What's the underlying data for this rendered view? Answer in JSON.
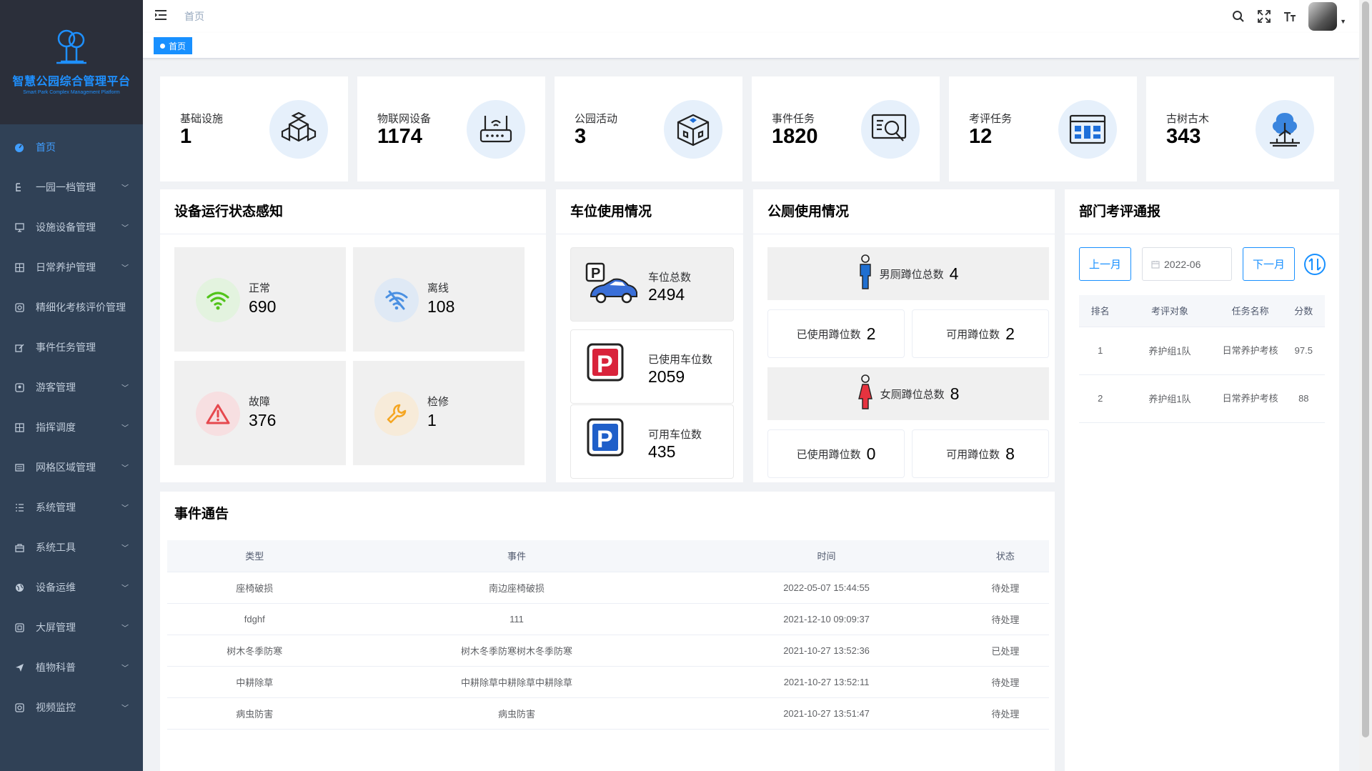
{
  "app": {
    "logo_title": "智慧公园综合管理平台",
    "logo_subtitle": "Smart Park Complex Management Platform",
    "breadcrumb": "首页",
    "active_tag": "首页"
  },
  "sidebar": {
    "items": [
      {
        "label": "首页",
        "icon": "dashboard-icon",
        "active": true
      },
      {
        "label": "一园一档管理",
        "icon": "tree-icon"
      },
      {
        "label": "设施设备管理",
        "icon": "monitor-icon"
      },
      {
        "label": "日常养护管理",
        "icon": "grid-icon"
      },
      {
        "label": "精细化考核评价管理",
        "icon": "target-icon"
      },
      {
        "label": "事件任务管理",
        "icon": "edit-icon"
      },
      {
        "label": "游客管理",
        "icon": "user-icon"
      },
      {
        "label": "指挥调度",
        "icon": "grid-icon"
      },
      {
        "label": "网格区域管理",
        "icon": "list-icon"
      },
      {
        "label": "系统管理",
        "icon": "menu-list-icon"
      },
      {
        "label": "系统工具",
        "icon": "tool-icon"
      },
      {
        "label": "设备运维",
        "icon": "globe-icon"
      },
      {
        "label": "大屏管理",
        "icon": "screen-icon"
      },
      {
        "label": "植物科普",
        "icon": "send-icon"
      },
      {
        "label": "视频监控",
        "icon": "camera-icon"
      }
    ]
  },
  "stats": [
    {
      "label": "基础设施",
      "value": "1",
      "icon": "cubes-icon"
    },
    {
      "label": "物联网设备",
      "value": "1174",
      "icon": "router-icon"
    },
    {
      "label": "公园活动",
      "value": "3",
      "icon": "box-icon"
    },
    {
      "label": "事件任务",
      "value": "1820",
      "icon": "search-screen-icon"
    },
    {
      "label": "考评任务",
      "value": "12",
      "icon": "dashboard-board-icon"
    },
    {
      "label": "古树古木",
      "value": "343",
      "icon": "tree-icon"
    }
  ],
  "device_status": {
    "title": "设备运行状态感知",
    "items": [
      {
        "label": "正常",
        "value": "690",
        "color": "#52c41a",
        "bg": "#e3f3df"
      },
      {
        "label": "离线",
        "value": "108",
        "color": "#4a90e2",
        "bg": "#dfe9f5"
      },
      {
        "label": "故障",
        "value": "376",
        "color": "#e6484e",
        "bg": "#f7dfe1"
      },
      {
        "label": "检修",
        "value": "1",
        "color": "#f5a623",
        "bg": "#f7ebd9"
      }
    ]
  },
  "parking": {
    "title": "车位使用情况",
    "items": [
      {
        "label": "车位总数",
        "value": "2494"
      },
      {
        "label": "已使用车位数",
        "value": "2059"
      },
      {
        "label": "可用车位数",
        "value": "435"
      }
    ]
  },
  "toilet": {
    "title": "公厕使用情况",
    "male_label": "男厕蹲位总数",
    "male_total": "4",
    "male_used_label": "已使用蹲位数",
    "male_used": "2",
    "male_free_label": "可用蹲位数",
    "male_free": "2",
    "female_label": "女厕蹲位总数",
    "female_total": "8",
    "female_used_label": "已使用蹲位数",
    "female_used": "0",
    "female_free_label": "可用蹲位数",
    "female_free": "8"
  },
  "dept_report": {
    "title": "部门考评通报",
    "prev_label": "上一月",
    "next_label": "下一月",
    "date_value": "2022-06",
    "headers": [
      "排名",
      "考评对象",
      "任务名称",
      "分数"
    ],
    "rows": [
      [
        "1",
        "养护组1队",
        "日常养护考核",
        "97.5"
      ],
      [
        "2",
        "养护组1队",
        "日常养护考核",
        "88"
      ]
    ]
  },
  "events": {
    "title": "事件通告",
    "headers": [
      "类型",
      "事件",
      "时间",
      "状态"
    ],
    "rows": [
      [
        "座椅破损",
        "南边座椅破损",
        "2022-05-07 15:44:55",
        "待处理"
      ],
      [
        "fdghf",
        "111",
        "2021-12-10 09:09:37",
        "待处理"
      ],
      [
        "树木冬季防寒",
        "树木冬季防寒树木冬季防寒",
        "2021-10-27 13:52:36",
        "已处理"
      ],
      [
        "中耕除草",
        "中耕除草中耕除草中耕除草",
        "2021-10-27 13:52:11",
        "待处理"
      ],
      [
        "病虫防害",
        "病虫防害",
        "2021-10-27 13:51:47",
        "待处理"
      ]
    ]
  }
}
